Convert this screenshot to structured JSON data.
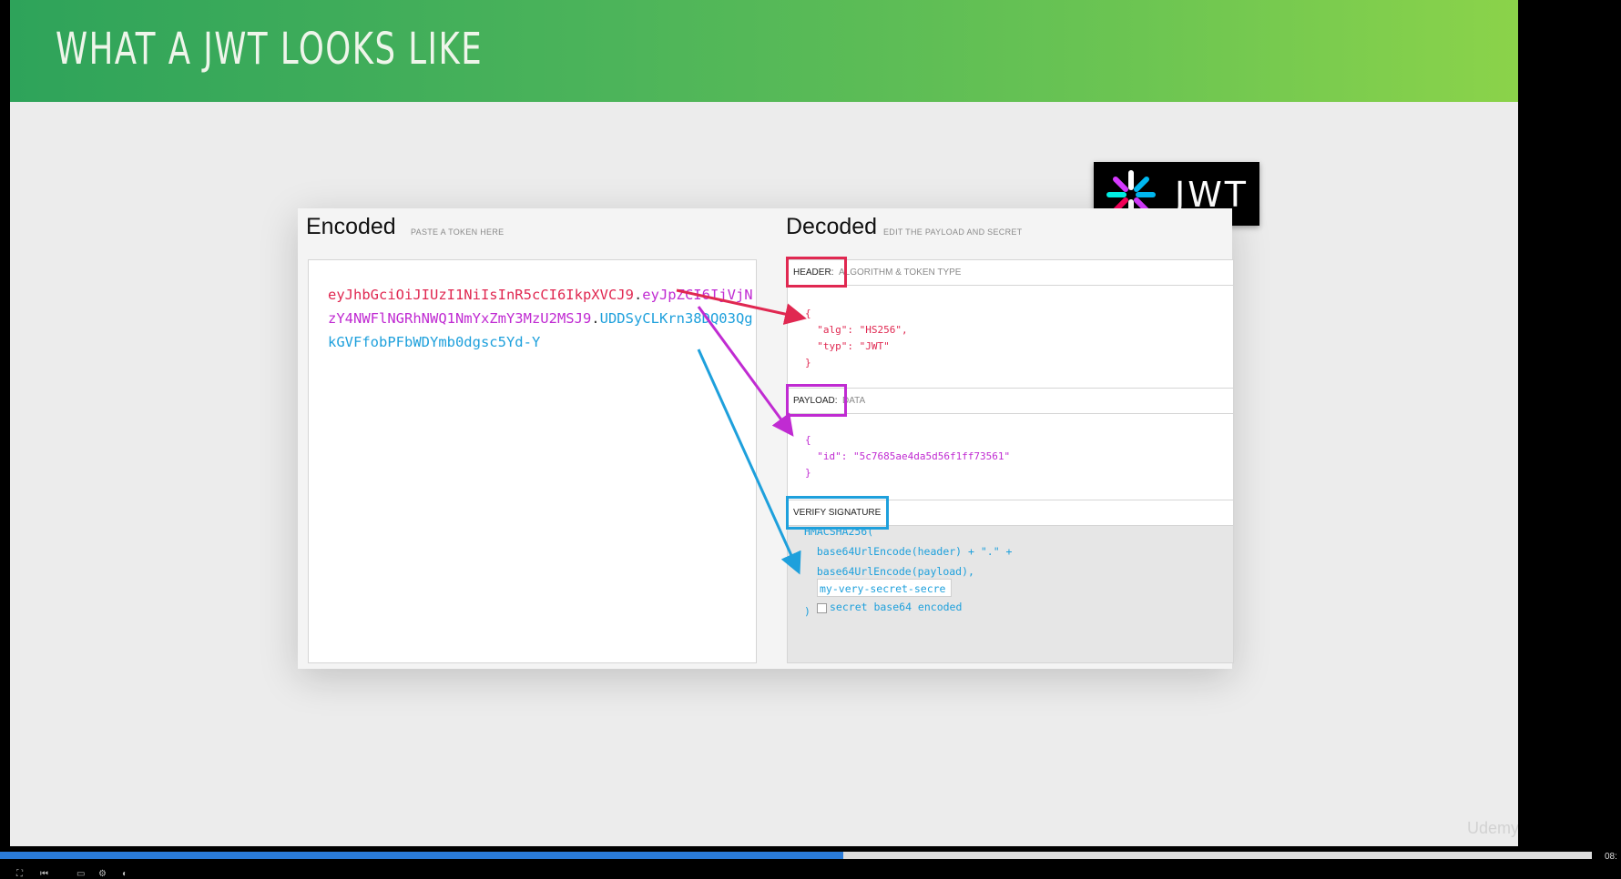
{
  "slide": {
    "title": "WHAT A JWT LOOKS LIKE",
    "logo_text": "JWT",
    "watermark": "Udemy"
  },
  "encoded": {
    "title": "Encoded",
    "subtitle": "PASTE A TOKEN HERE",
    "token_header": "eyJhbGciOiJIUzI1NiIsInR5cCI6IkpXVCJ9",
    "token_payload": "eyJpZCI6IjVjNzY4NWFlNGRhNWQ1NmYxZmY3MzU2MSJ9",
    "token_signature": "UDDSyCLKrn38DQ03QgkGVFfobPFbWDYmb0dgsc5Yd-Y",
    "dot": "."
  },
  "decoded": {
    "title": "Decoded",
    "subtitle": "EDIT THE PAYLOAD AND SECRET",
    "header": {
      "label": "HEADER:",
      "desc": "ALGORITHM & TOKEN TYPE",
      "json": "{\n  \"alg\": \"HS256\",\n  \"typ\": \"JWT\"\n}"
    },
    "payload": {
      "label": "PAYLOAD:",
      "desc": "DATA",
      "json": "{\n  \"id\": \"5c7685ae4da5d56f1ff73561\"\n}"
    },
    "signature": {
      "label": "VERIFY SIGNATURE",
      "code": "HMACSHA256(\n  base64UrlEncode(header) + \".\" +\n  base64UrlEncode(payload),\n\n)",
      "secret": "my-very-secret-secre",
      "checkbox_label": "secret base64 encoded"
    }
  },
  "player": {
    "progress": 0.53,
    "time": "08:"
  },
  "colors": {
    "header": "#e02851",
    "payload": "#c02bd2",
    "signature": "#1ea0dc",
    "progress": "#2a7bd8"
  }
}
